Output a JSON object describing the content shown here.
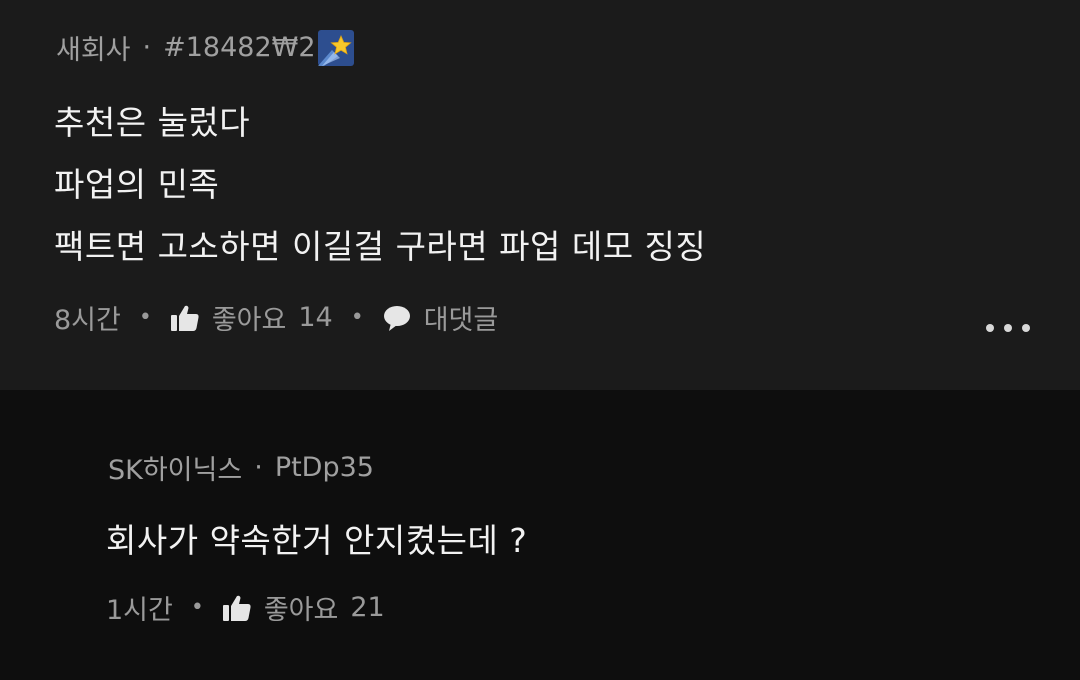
{
  "comments": [
    {
      "author": "새회사",
      "separator": "·",
      "tag": "#18482₩2",
      "emoji_icon": "shooting-star-icon",
      "body_lines": [
        "추천은 눌렀다",
        "파업의 민족",
        "팩트면 고소하면 이길걸 구라면 파업 데모 징징"
      ],
      "time": "8시간",
      "like_label": "좋아요",
      "like_count": "14",
      "reply_label": "대댓글",
      "more_icon": "more-horizontal-icon"
    }
  ],
  "reply": {
    "author": "SK하이닉스",
    "separator": "·",
    "tag": "PtDp35",
    "body": "회사가 약속한거 안지켰는데 ?",
    "time": "1시간",
    "like_label": "좋아요",
    "like_count": "21"
  },
  "colors": {
    "main_bg": "#1b1b1b",
    "reply_bg": "#0e0e0e",
    "text_primary": "#f2f2f2",
    "text_meta": "#a0a0a0"
  }
}
